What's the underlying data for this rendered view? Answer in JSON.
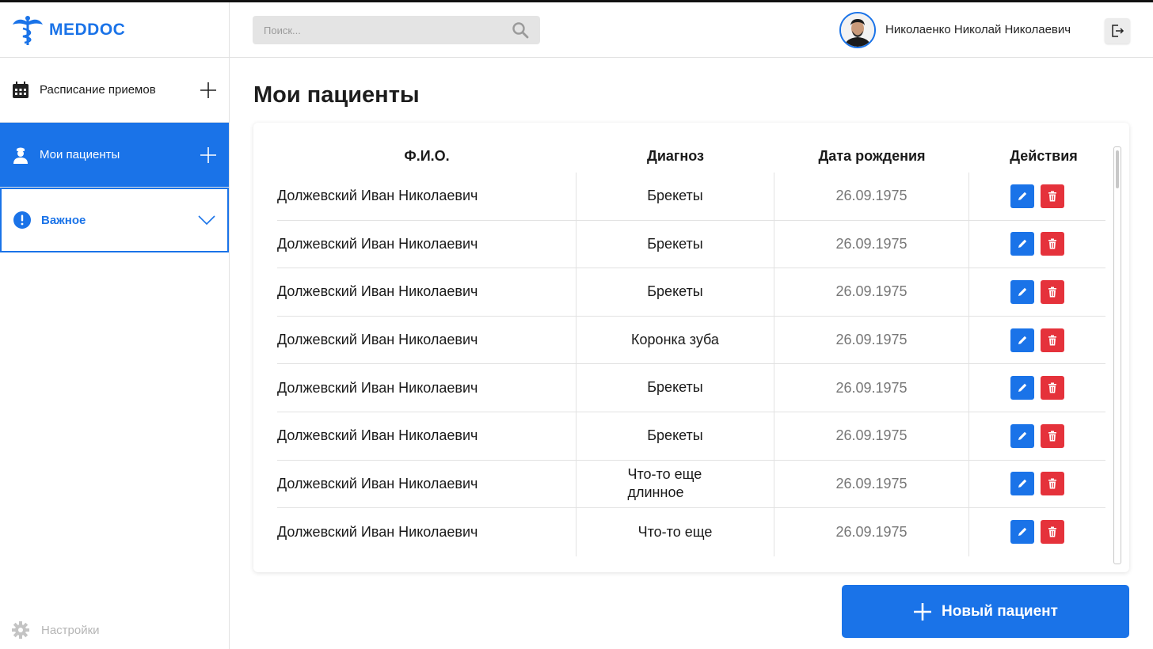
{
  "app": {
    "logo_text": "MEDDOC"
  },
  "sidebar": {
    "items": [
      {
        "label": "Расписание приемов",
        "icon": "calendar-icon"
      },
      {
        "label": "Мои пациенты",
        "icon": "doctor-icon"
      },
      {
        "label": "Важное",
        "icon": "alert-icon"
      }
    ],
    "settings_label": "Настройки"
  },
  "header": {
    "search_placeholder": "Поиск...",
    "user_name": "Николаенко Николай Николаевич"
  },
  "main": {
    "title": "Мои пациенты",
    "columns": [
      "Ф.И.О.",
      "Диагноз",
      "Дата рождения",
      "Действия"
    ],
    "rows": [
      {
        "name": "Должевский Иван Николаевич",
        "diagnosis": "Брекеты",
        "birth_date": "26.09.1975"
      },
      {
        "name": "Должевский Иван Николаевич",
        "diagnosis": "Брекеты",
        "birth_date": "26.09.1975"
      },
      {
        "name": "Должевский Иван Николаевич",
        "diagnosis": "Брекеты",
        "birth_date": "26.09.1975"
      },
      {
        "name": "Должевский Иван Николаевич",
        "diagnosis": "Коронка зуба",
        "birth_date": "26.09.1975"
      },
      {
        "name": "Должевский Иван Николаевич",
        "diagnosis": "Брекеты",
        "birth_date": "26.09.1975"
      },
      {
        "name": "Должевский Иван Николаевич",
        "diagnosis": "Брекеты",
        "birth_date": "26.09.1975"
      },
      {
        "name": "Должевский Иван Николаевич",
        "diagnosis": "Что-то еще длинное",
        "birth_date": "26.09.1975"
      },
      {
        "name": "Должевский Иван Николаевич",
        "diagnosis": "Что-то еще",
        "birth_date": "26.09.1975"
      }
    ],
    "new_patient_label": "Новый пациент"
  },
  "colors": {
    "accent": "#1a73e8",
    "danger": "#e5323b"
  }
}
